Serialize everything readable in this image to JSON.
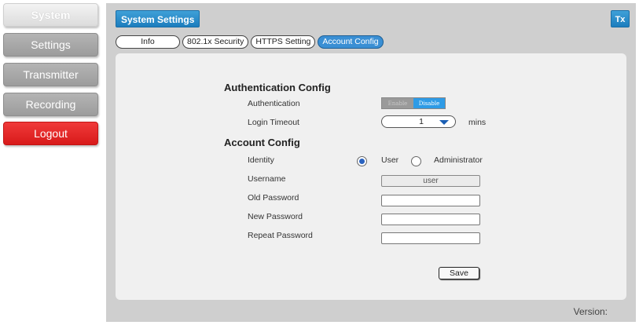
{
  "nav": {
    "system": "System",
    "settings": "Settings",
    "transmitter": "Transmitter",
    "recording": "Recording",
    "logout": "Logout"
  },
  "header": {
    "title": "System Settings",
    "device": "Tx"
  },
  "tabs": {
    "info": "Info",
    "security": "802.1x Security",
    "https": "HTTPS Setting",
    "account": "Account Config"
  },
  "auth": {
    "title": "Authentication Config",
    "auth_label": "Authentication",
    "enable": "Enable",
    "disable": "Disable",
    "timeout_label": "Login Timeout",
    "timeout_value": "1",
    "timeout_unit": "mins"
  },
  "account": {
    "title": "Account Config",
    "identity_label": "Identity",
    "user_option": "User",
    "admin_option": "Administrator",
    "username_label": "Username",
    "username_value": "user",
    "old_password_label": "Old Password",
    "new_password_label": "New Password",
    "repeat_password_label": "Repeat Password",
    "save": "Save"
  },
  "footer": {
    "version": "Version:"
  },
  "colors": {
    "accent": "#1c7dbd",
    "logout": "#e02525",
    "frame": "#cfcfcf",
    "panel": "#f0f0f0"
  }
}
